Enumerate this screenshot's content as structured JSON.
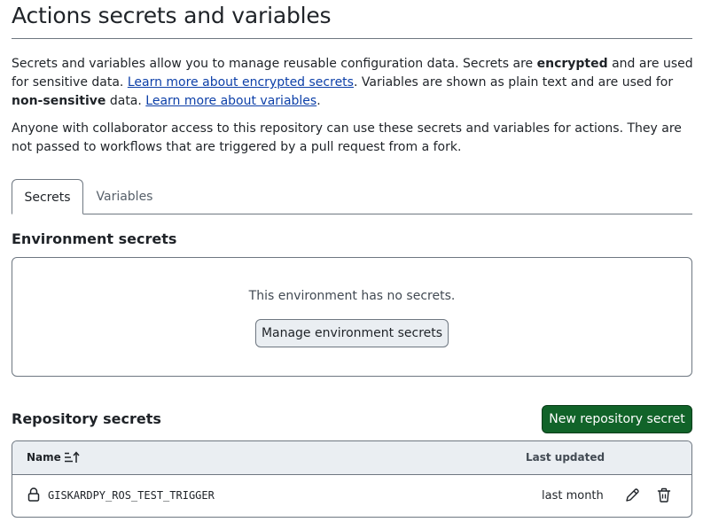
{
  "header": {
    "title": "Actions secrets and variables"
  },
  "intro": {
    "p1_part1": "Secrets and variables allow you to manage reusable configuration data. Secrets are ",
    "p1_bold1": "encrypted",
    "p1_part2": " and are used for sensitive data. ",
    "p1_link1": "Learn more about encrypted secrets",
    "p1_part3": ". Variables are shown as plain text and are used for ",
    "p1_bold2": "non-sensitive",
    "p1_part4": " data. ",
    "p1_link2": "Learn more about variables",
    "p1_part5": ".",
    "p2": "Anyone with collaborator access to this repository can use these secrets and variables for actions. They are not passed to workflows that are triggered by a pull request from a fork."
  },
  "tabs": [
    {
      "label": "Secrets",
      "selected": true
    },
    {
      "label": "Variables",
      "selected": false
    }
  ],
  "environment": {
    "heading": "Environment secrets",
    "empty_text": "This environment has no secrets.",
    "manage_button": "Manage environment secrets"
  },
  "repository": {
    "heading": "Repository secrets",
    "new_button": "New repository secret",
    "columns": {
      "name": "Name",
      "updated": "Last updated"
    },
    "rows": [
      {
        "name": "GISKARDPY_ROS_TEST_TRIGGER",
        "updated": "last month"
      }
    ]
  },
  "icons": {
    "sort": "sort-ascending-icon",
    "lock": "lock-icon",
    "edit": "pencil-icon",
    "delete": "trash-icon"
  },
  "colors": {
    "primary_button": "#116329",
    "link": "#0c3fa8",
    "table_header_bg": "#eaeef2",
    "border": "#6e7781"
  }
}
